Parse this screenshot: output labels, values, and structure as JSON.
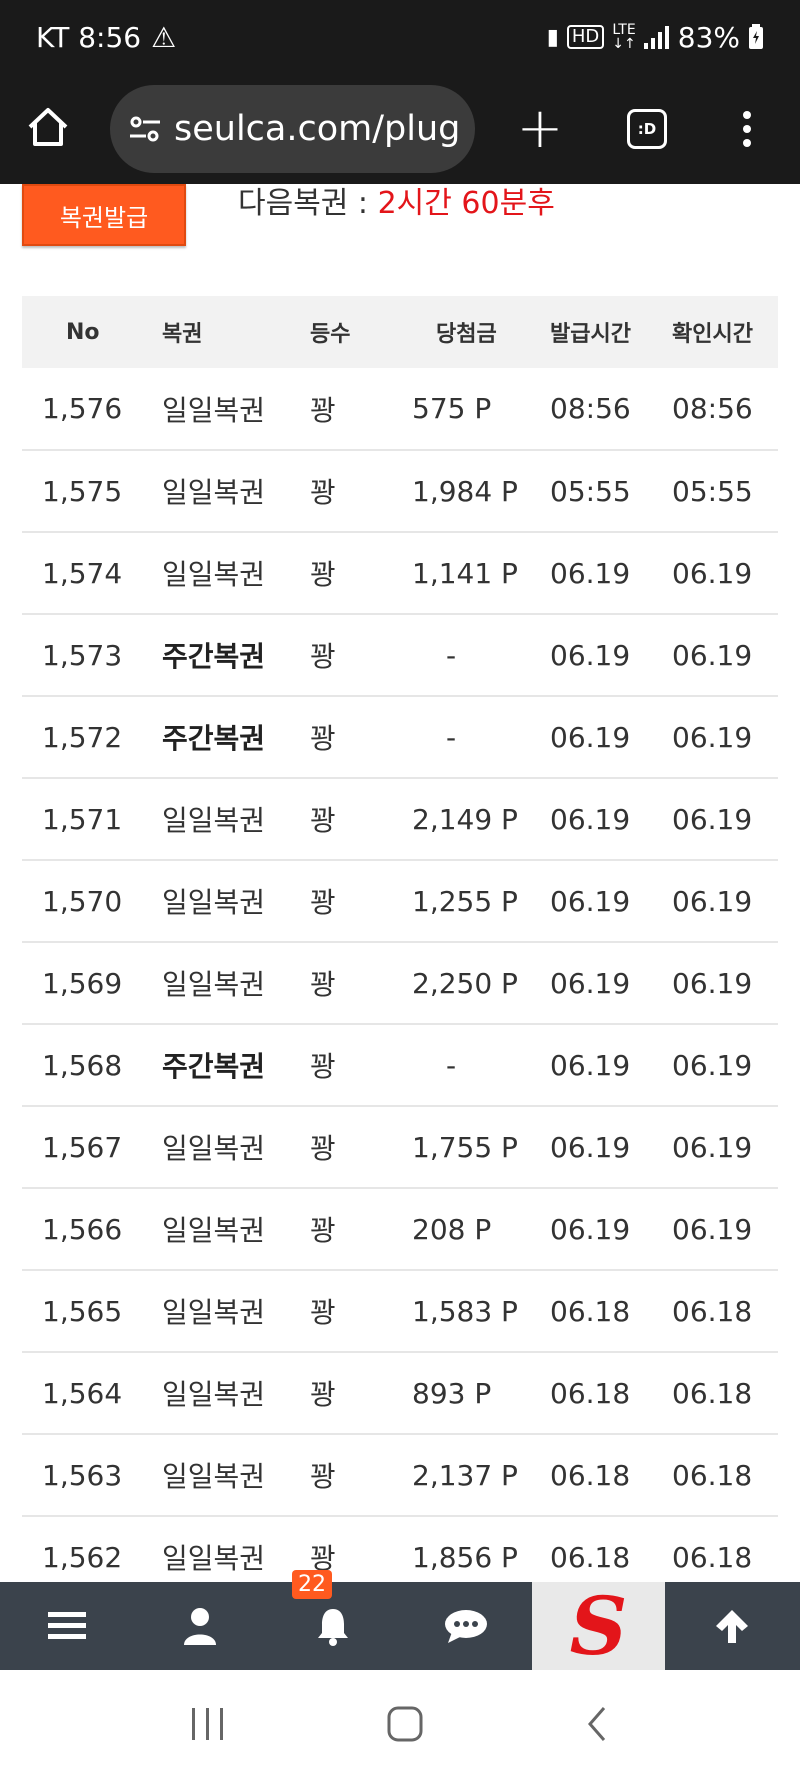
{
  "status": {
    "carrier_time": "KT 8:56",
    "battery": "83%",
    "network": "LTE"
  },
  "browser": {
    "url": "seulca.com/plug",
    "tabs_label": ":D"
  },
  "page": {
    "issue_button": "복권발급",
    "next_label": "다음복권 : ",
    "next_time": "2시간 60분후",
    "accent_color": "#ff5a1f",
    "highlight_color": "#e3151a"
  },
  "table": {
    "headers": [
      "No",
      "복권",
      "등수",
      "당첨금",
      "발급시간",
      "확인시간"
    ],
    "rows": [
      {
        "no": "1,576",
        "type": "일일복권",
        "rank": "꽝",
        "prize": "575 P",
        "issued": "08:56",
        "checked": "08:56",
        "bold": false
      },
      {
        "no": "1,575",
        "type": "일일복권",
        "rank": "꽝",
        "prize": "1,984 P",
        "issued": "05:55",
        "checked": "05:55",
        "bold": false
      },
      {
        "no": "1,574",
        "type": "일일복권",
        "rank": "꽝",
        "prize": "1,141 P",
        "issued": "06.19",
        "checked": "06.19",
        "bold": false
      },
      {
        "no": "1,573",
        "type": "주간복권",
        "rank": "꽝",
        "prize": "-",
        "issued": "06.19",
        "checked": "06.19",
        "bold": true
      },
      {
        "no": "1,572",
        "type": "주간복권",
        "rank": "꽝",
        "prize": "-",
        "issued": "06.19",
        "checked": "06.19",
        "bold": true
      },
      {
        "no": "1,571",
        "type": "일일복권",
        "rank": "꽝",
        "prize": "2,149 P",
        "issued": "06.19",
        "checked": "06.19",
        "bold": false
      },
      {
        "no": "1,570",
        "type": "일일복권",
        "rank": "꽝",
        "prize": "1,255 P",
        "issued": "06.19",
        "checked": "06.19",
        "bold": false
      },
      {
        "no": "1,569",
        "type": "일일복권",
        "rank": "꽝",
        "prize": "2,250 P",
        "issued": "06.19",
        "checked": "06.19",
        "bold": false
      },
      {
        "no": "1,568",
        "type": "주간복권",
        "rank": "꽝",
        "prize": "-",
        "issued": "06.19",
        "checked": "06.19",
        "bold": true
      },
      {
        "no": "1,567",
        "type": "일일복권",
        "rank": "꽝",
        "prize": "1,755 P",
        "issued": "06.19",
        "checked": "06.19",
        "bold": false
      },
      {
        "no": "1,566",
        "type": "일일복권",
        "rank": "꽝",
        "prize": "208 P",
        "issued": "06.19",
        "checked": "06.19",
        "bold": false
      },
      {
        "no": "1,565",
        "type": "일일복권",
        "rank": "꽝",
        "prize": "1,583 P",
        "issued": "06.18",
        "checked": "06.18",
        "bold": false
      },
      {
        "no": "1,564",
        "type": "일일복권",
        "rank": "꽝",
        "prize": "893 P",
        "issued": "06.18",
        "checked": "06.18",
        "bold": false
      },
      {
        "no": "1,563",
        "type": "일일복권",
        "rank": "꽝",
        "prize": "2,137 P",
        "issued": "06.18",
        "checked": "06.18",
        "bold": false
      },
      {
        "no": "1,562",
        "type": "일일복권",
        "rank": "꽝",
        "prize": "1,856 P",
        "issued": "06.18",
        "checked": "06.18",
        "bold": false
      }
    ]
  },
  "app_nav": {
    "notification_count": "22",
    "items": [
      "menu-icon",
      "user-icon",
      "bell-icon",
      "chat-icon",
      "site-logo",
      "arrow-up-icon"
    ]
  }
}
